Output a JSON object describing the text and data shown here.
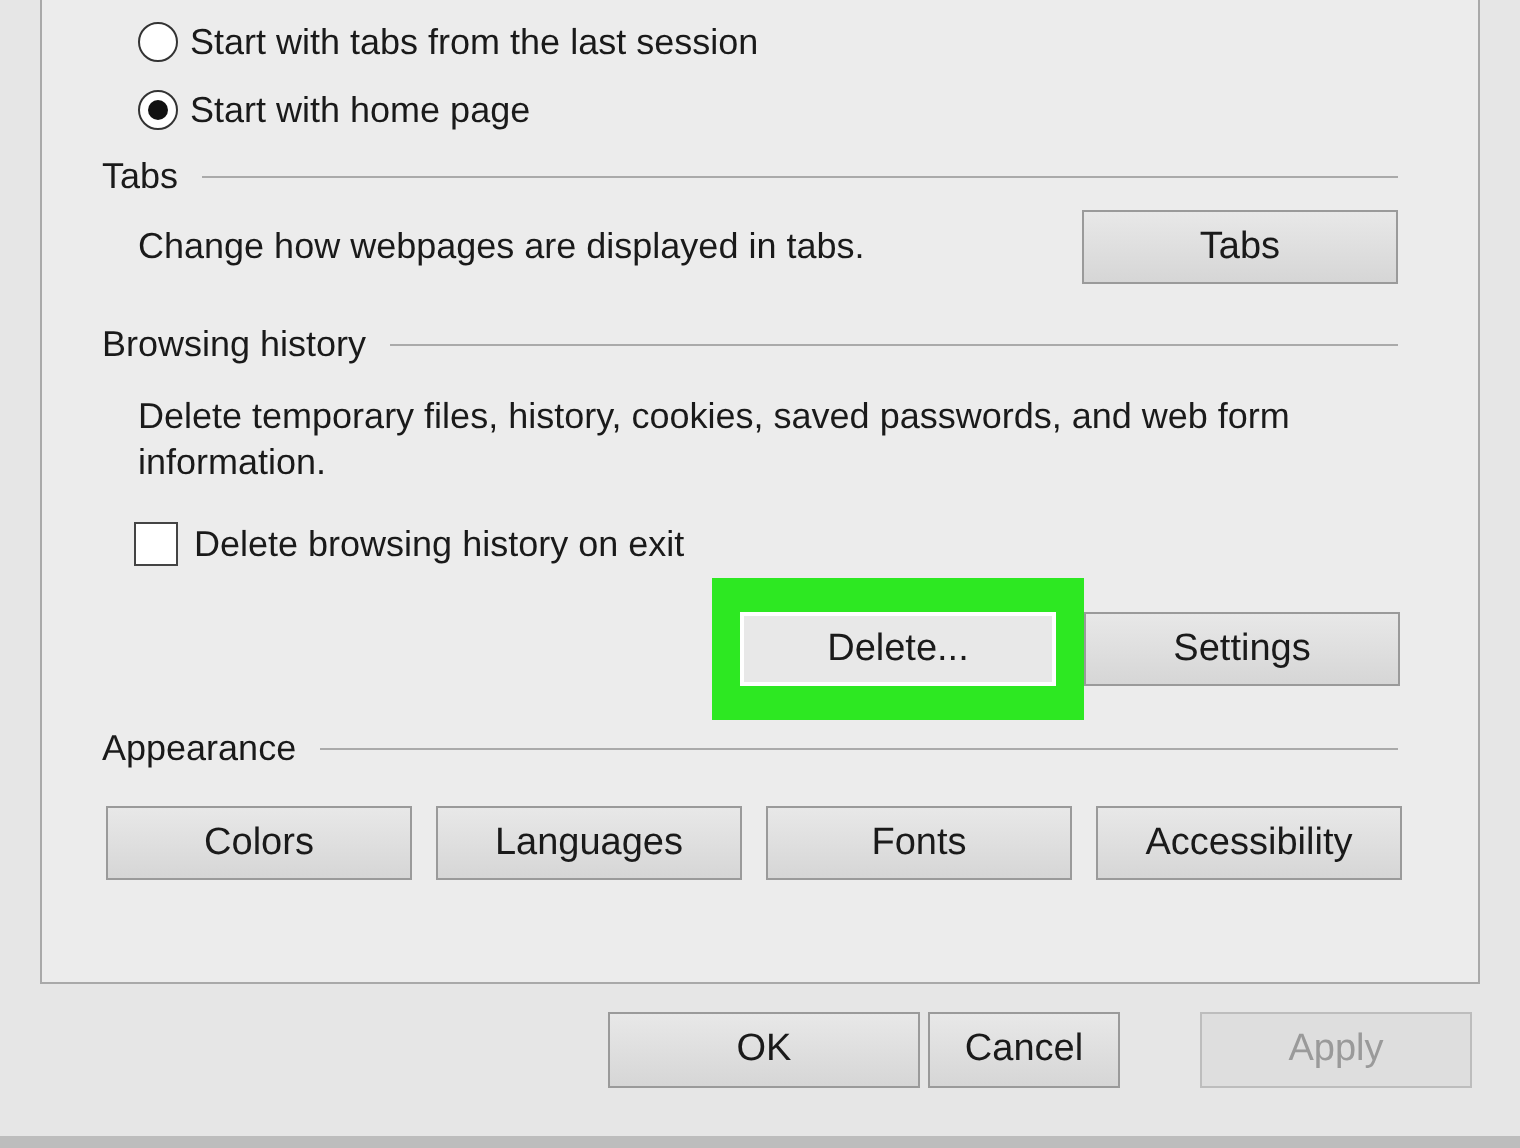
{
  "startup_options": [
    {
      "label": "Start with tabs from the last session",
      "selected": false
    },
    {
      "label": "Start with home page",
      "selected": true
    }
  ],
  "tabs_group": {
    "title": "Tabs",
    "description": "Change how webpages are displayed in tabs.",
    "button": "Tabs"
  },
  "browsing_history": {
    "title": "Browsing history",
    "description": "Delete temporary files, history, cookies, saved passwords, and web form information.",
    "checkbox": {
      "label": "Delete browsing history on exit",
      "checked": false
    },
    "buttons": [
      {
        "label": "Delete...",
        "highlighted": true
      },
      {
        "label": "Settings",
        "highlighted": false
      }
    ]
  },
  "appearance": {
    "title": "Appearance",
    "buttons": [
      "Colors",
      "Languages",
      "Fonts",
      "Accessibility"
    ]
  },
  "dialog_buttons": [
    {
      "label": "OK",
      "disabled": false
    },
    {
      "label": "Cancel",
      "disabled": false
    },
    {
      "label": "Apply",
      "disabled": true
    }
  ]
}
